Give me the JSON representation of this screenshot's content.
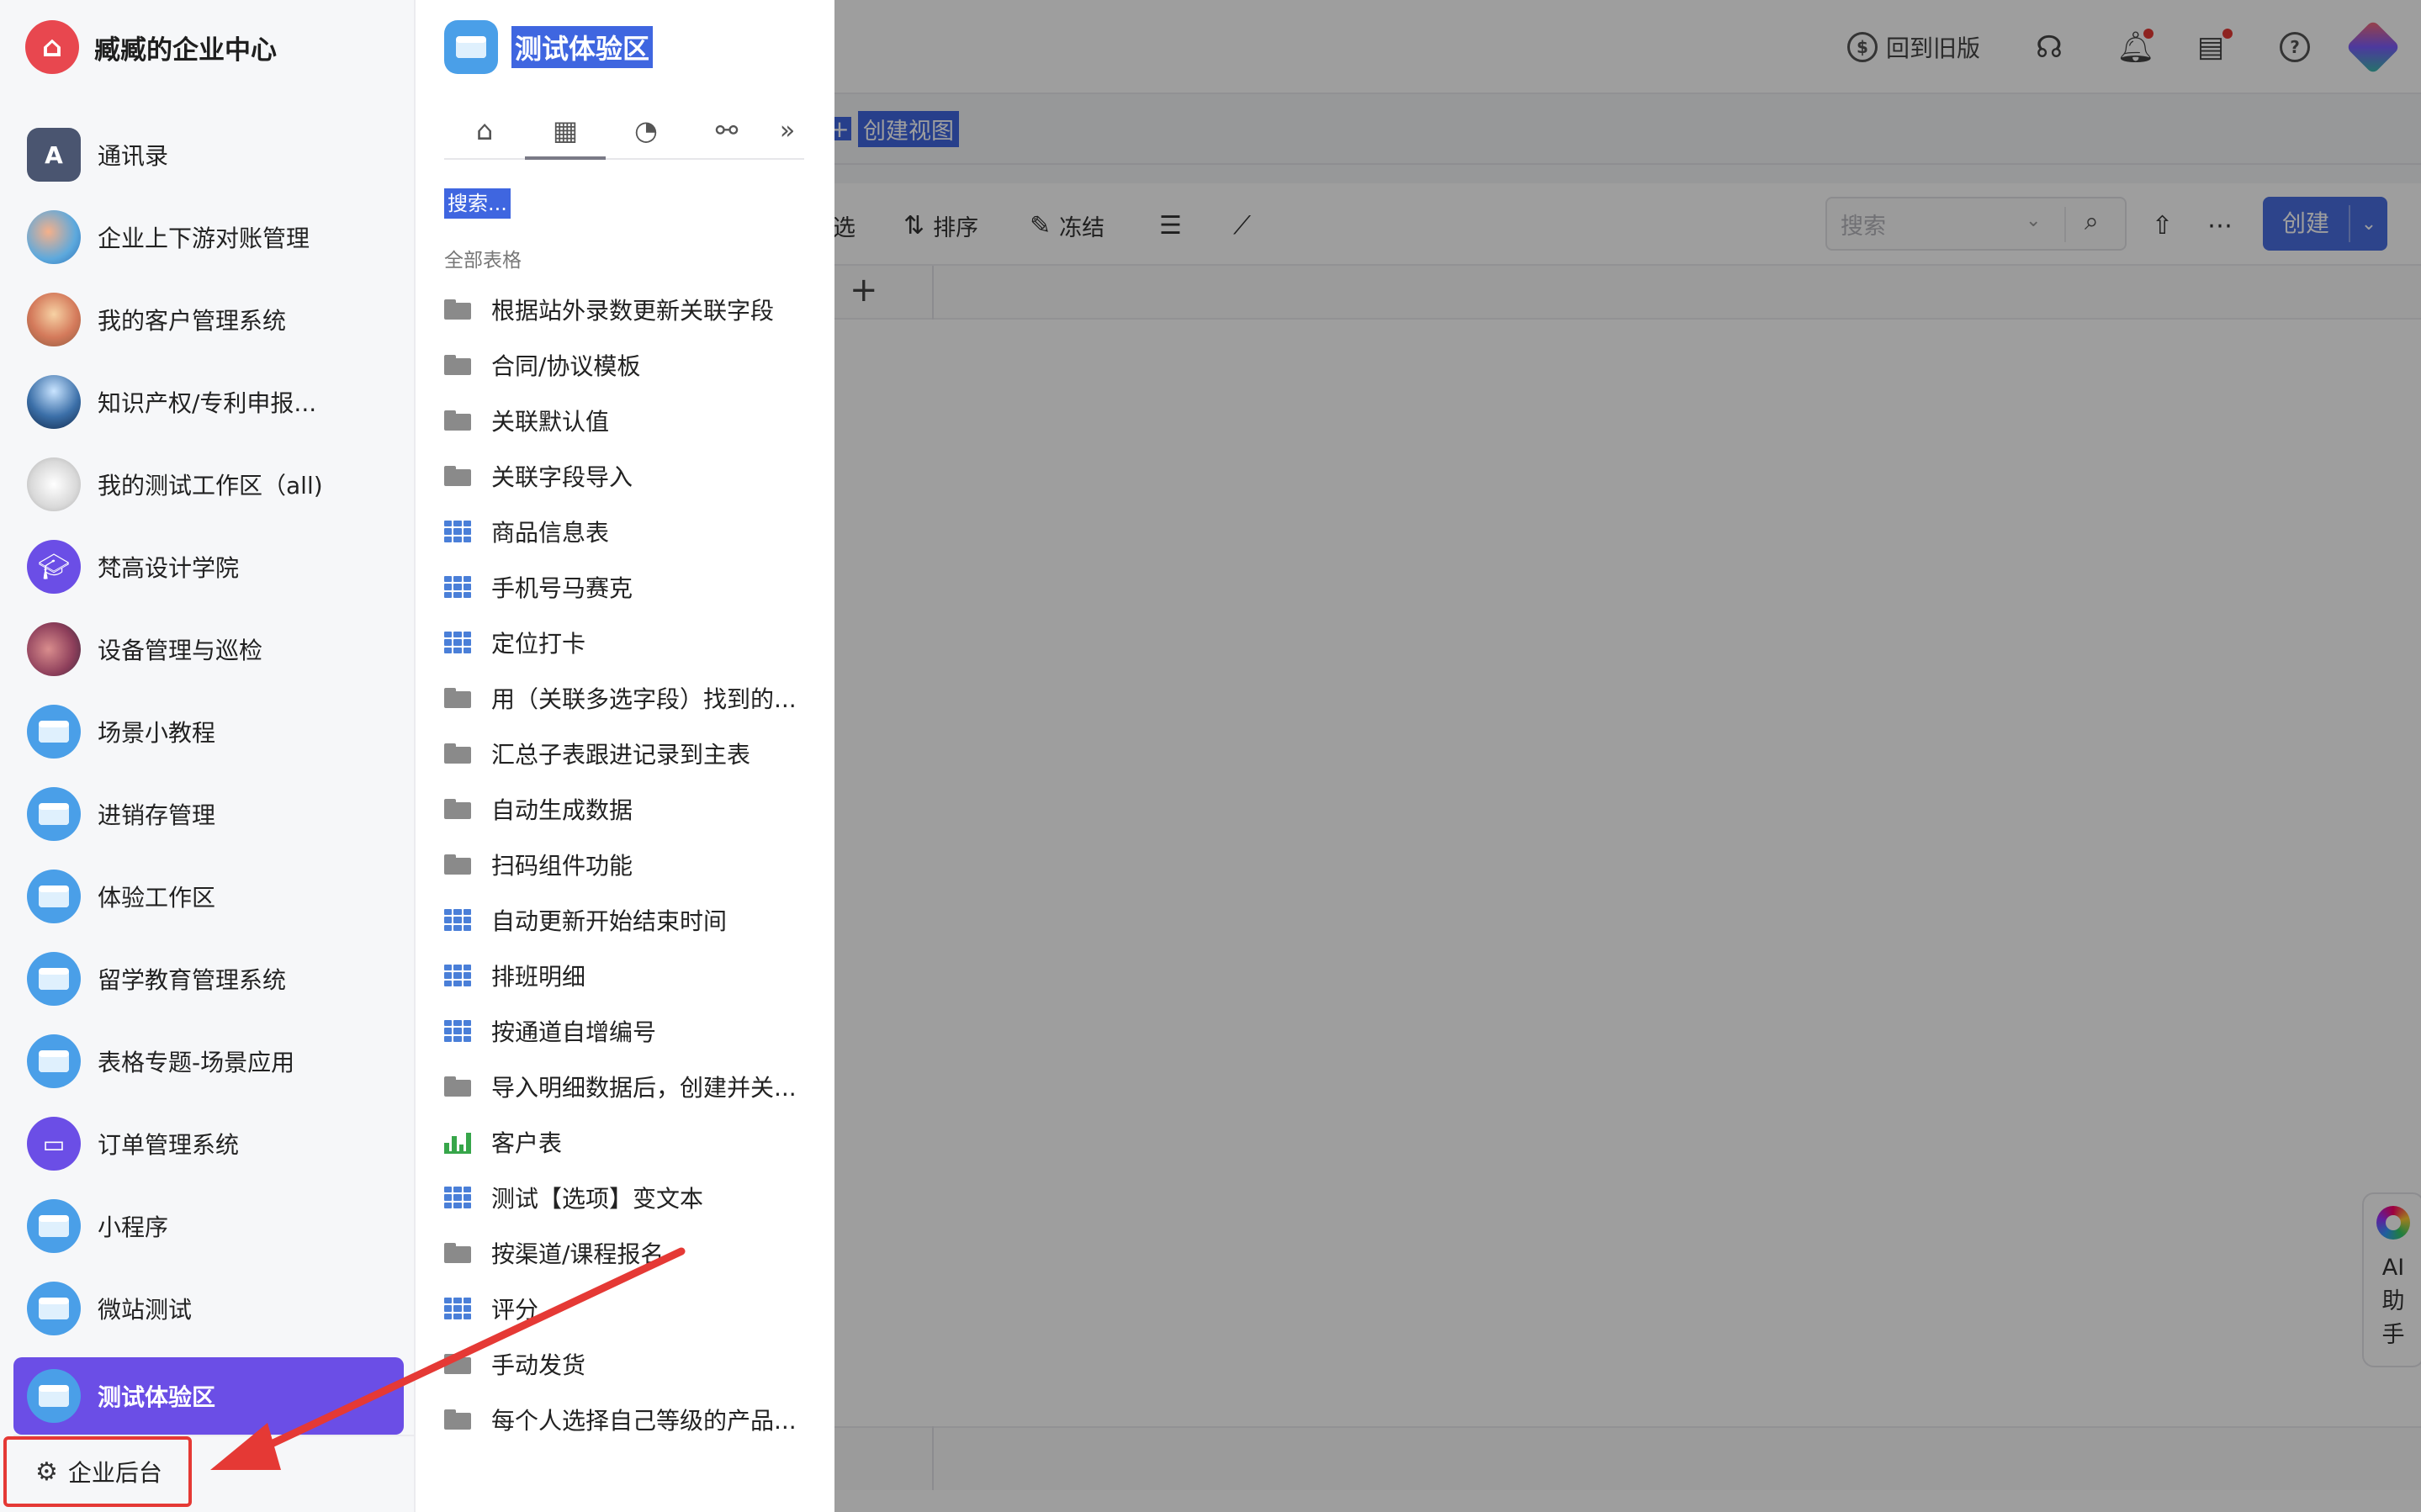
{
  "org": {
    "name": "臧臧的企业中心"
  },
  "nav": {
    "items": [
      {
        "label": "通讯录",
        "icon": "contacts-book-icon"
      },
      {
        "label": "企业上下游对账管理",
        "icon": "target-avatar-icon"
      },
      {
        "label": "我的客户管理系统",
        "icon": "photo-avatar-icon"
      },
      {
        "label": "知识产权/专利申报...",
        "icon": "photo-avatar-icon"
      },
      {
        "label": "我的测试工作区（all)",
        "icon": "photo-avatar-icon"
      },
      {
        "label": "梵高设计学院",
        "icon": "graduation-cap-icon"
      },
      {
        "label": "设备管理与巡检",
        "icon": "photo-avatar-icon"
      },
      {
        "label": "场景小教程",
        "icon": "workspace-window-icon"
      },
      {
        "label": "进销存管理",
        "icon": "workspace-window-icon"
      },
      {
        "label": "体验工作区",
        "icon": "workspace-window-icon"
      },
      {
        "label": "留学教育管理系统",
        "icon": "workspace-window-icon"
      },
      {
        "label": "表格专题-场景应用",
        "icon": "workspace-window-icon"
      },
      {
        "label": "订单管理系统",
        "icon": "inbox-tray-icon"
      },
      {
        "label": "小程序",
        "icon": "workspace-window-icon"
      },
      {
        "label": "微站测试",
        "icon": "workspace-window-icon"
      },
      {
        "label": "测试体验区",
        "icon": "workspace-window-icon",
        "active": true
      }
    ],
    "admin_label": "企业后台"
  },
  "panel": {
    "title": "测试体验区",
    "search_placeholder": "搜索...",
    "section_label": "全部表格",
    "tabs": [
      {
        "icon": "home-icon",
        "glyph": "⌂"
      },
      {
        "icon": "table-icon",
        "glyph": "▦",
        "active": true
      },
      {
        "icon": "pie-chart-icon",
        "glyph": "◔"
      },
      {
        "icon": "workflow-icon",
        "glyph": "⚯"
      }
    ],
    "tabs_more": "»",
    "items": [
      {
        "name": "根据站外录数更新关联字段",
        "type": "folder"
      },
      {
        "name": "合同/协议模板",
        "type": "folder"
      },
      {
        "name": "关联默认值",
        "type": "folder"
      },
      {
        "name": "关联字段导入",
        "type": "folder"
      },
      {
        "name": "商品信息表",
        "type": "table"
      },
      {
        "name": "手机号马赛克",
        "type": "table"
      },
      {
        "name": "定位打卡",
        "type": "table"
      },
      {
        "name": "用（关联多选字段）找到的...",
        "type": "folder"
      },
      {
        "name": "汇总子表跟进记录到主表",
        "type": "folder"
      },
      {
        "name": "自动生成数据",
        "type": "folder"
      },
      {
        "name": "扫码组件功能",
        "type": "folder"
      },
      {
        "name": "自动更新开始结束时间",
        "type": "table"
      },
      {
        "name": "排班明细",
        "type": "table"
      },
      {
        "name": "按通道自增编号",
        "type": "table"
      },
      {
        "name": "导入明细数据后，创建并关...",
        "type": "folder"
      },
      {
        "name": "客户表",
        "type": "chart"
      },
      {
        "name": "测试【选项】变文本",
        "type": "table"
      },
      {
        "name": "按渠道/课程报名",
        "type": "folder"
      },
      {
        "name": "评分",
        "type": "table"
      },
      {
        "name": "手动发货",
        "type": "folder"
      },
      {
        "name": "每个人选择自己等级的产品...",
        "type": "folder"
      }
    ]
  },
  "background": {
    "back_to_old": "回到旧版",
    "create_view": "创建视图",
    "toolbar": {
      "filter": "选",
      "sort": "排序",
      "freeze": "冻结"
    },
    "search_placeholder": "搜索",
    "create_label": "创建",
    "ai_assistant": [
      "AI",
      "助",
      "手"
    ]
  },
  "colors": {
    "active_nav": "#6b4ee6",
    "selection": "#3f66e0",
    "annotation": "#e53935",
    "primary_button": "#4a6ee0"
  }
}
